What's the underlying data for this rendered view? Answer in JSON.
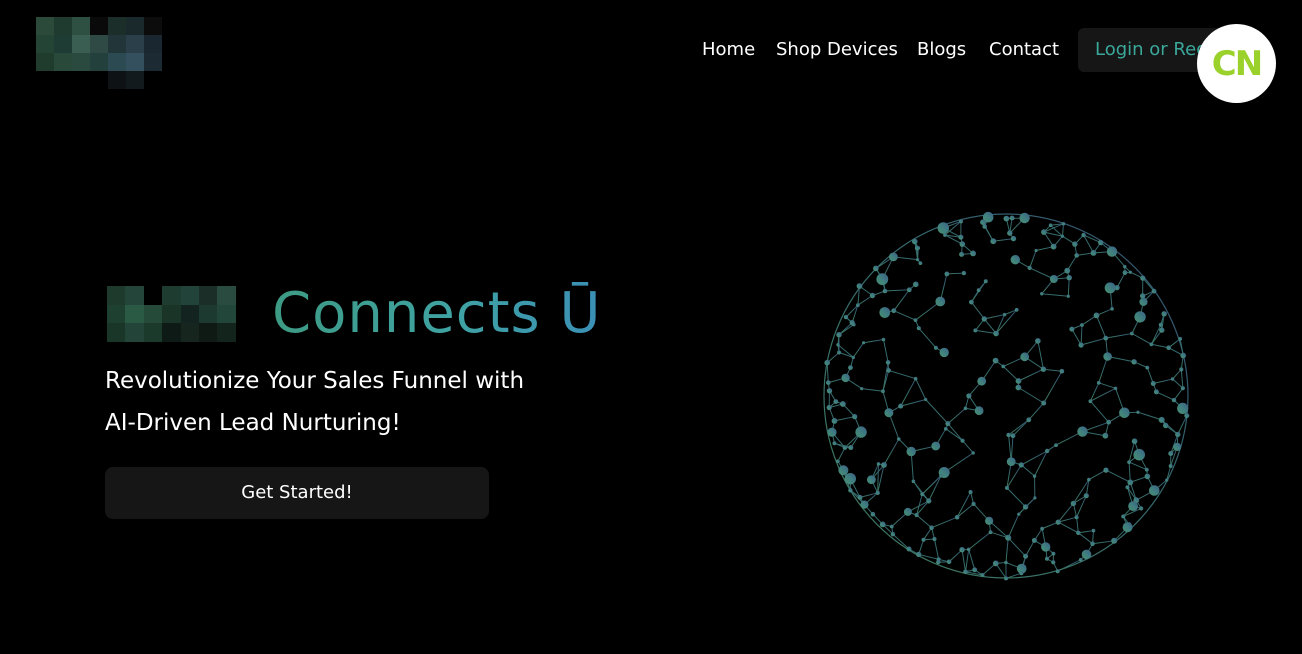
{
  "header": {
    "nav": {
      "home": "Home",
      "shop": "Shop Devices",
      "blogs": "Blogs",
      "contact": "Contact"
    },
    "login_label": "Login or Register",
    "badge_text": "CN"
  },
  "hero": {
    "title": "Connects Ū",
    "subtitle_line1": "Revolutionize Your Sales Funnel with",
    "subtitle_line2": "AI-Driven Lead Nurturing!",
    "cta_label": "Get Started!"
  },
  "colors": {
    "background": "#000000",
    "accent": "#3aa89a",
    "button_bg": "#161616",
    "badge_green": "#9bd12b"
  },
  "icons": {
    "logo": "pixelated-logo",
    "brand_mark": "pixelated-brand-mark",
    "globe": "network-globe"
  }
}
